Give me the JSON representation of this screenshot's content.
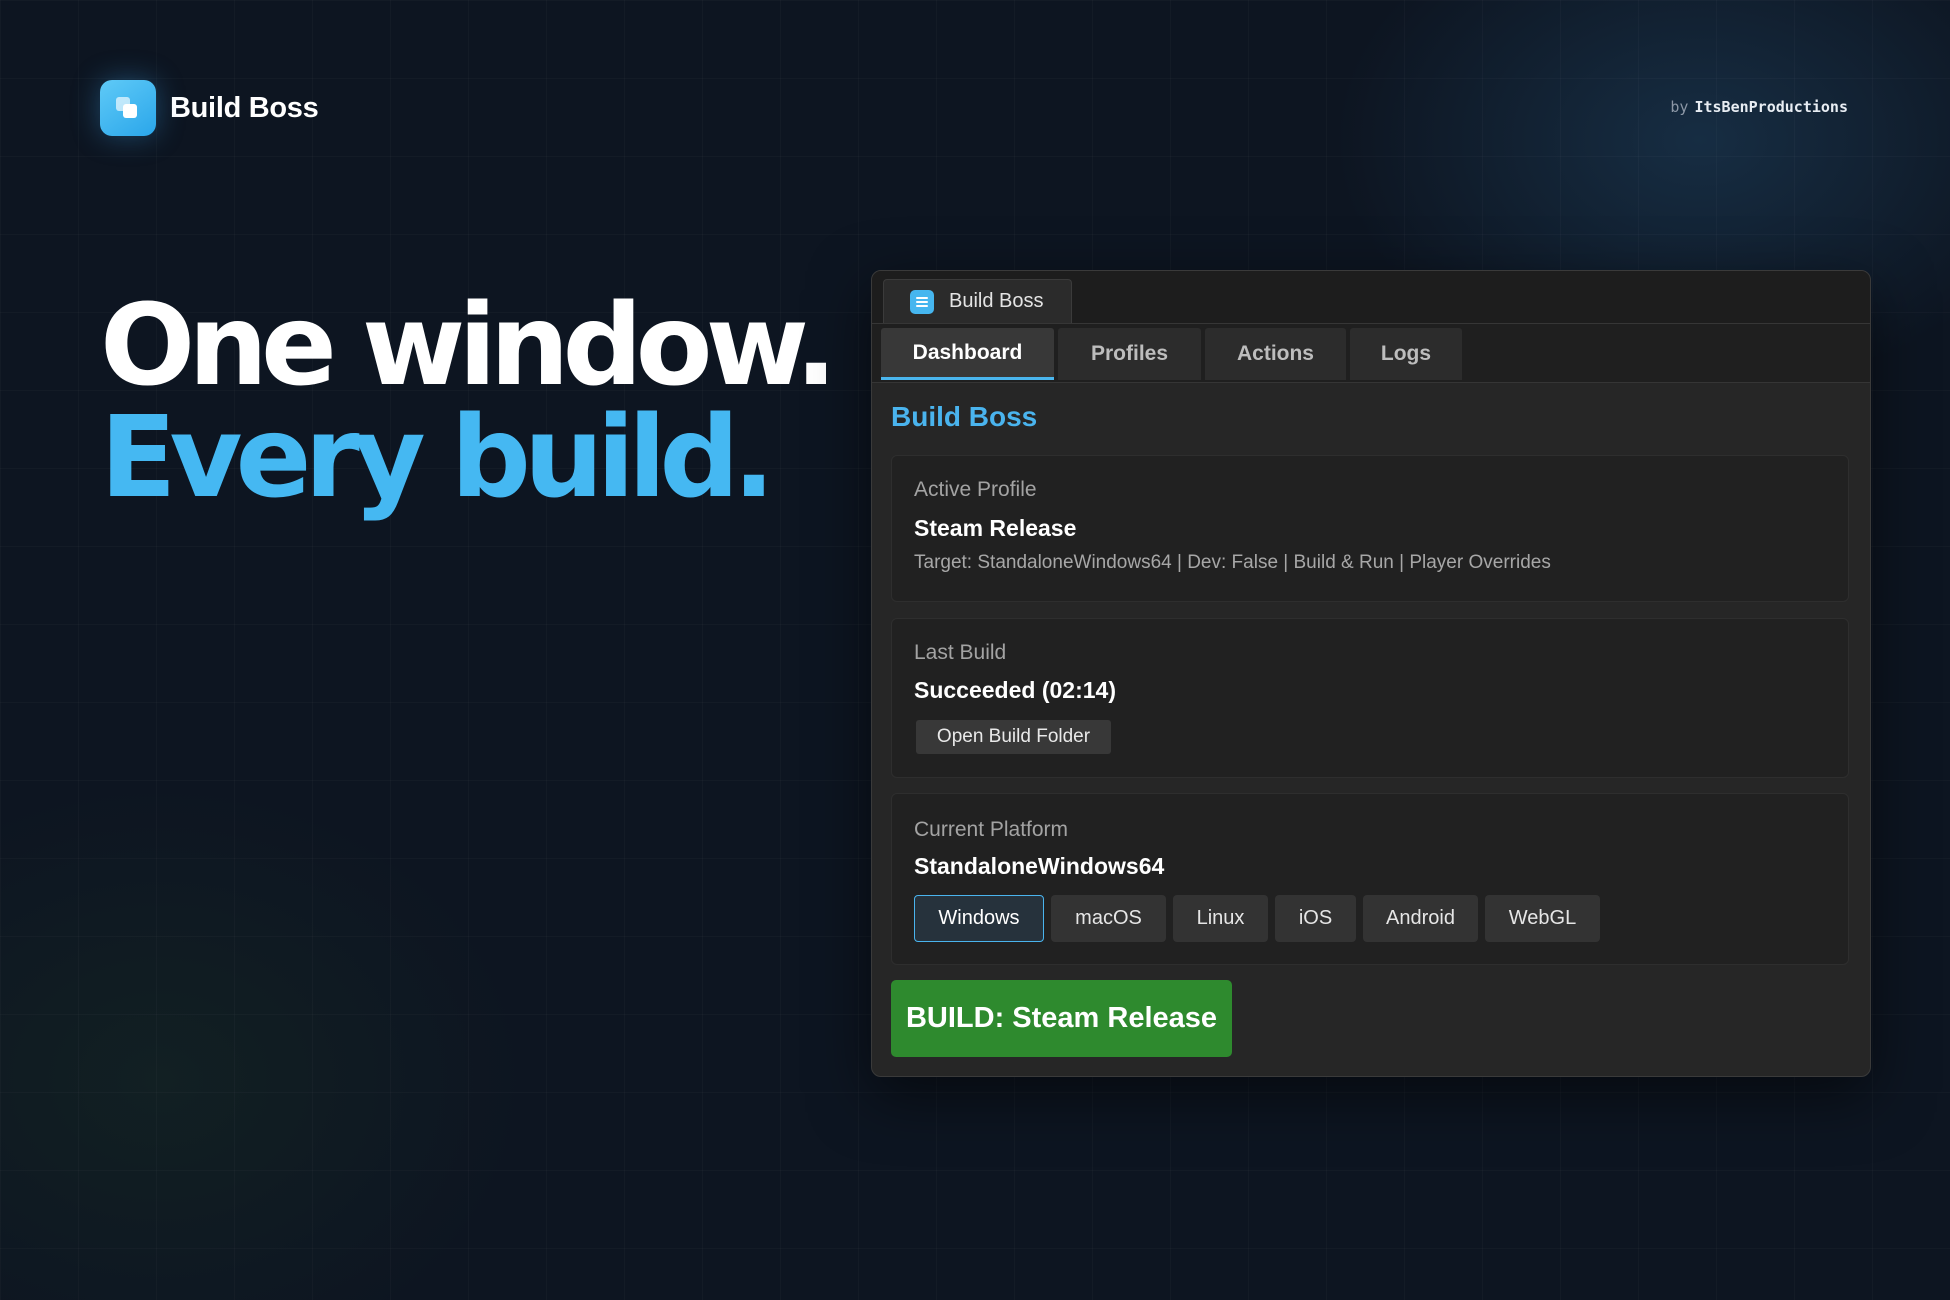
{
  "brand": {
    "name": "Build Boss",
    "by_prefix": "by",
    "by_name": "ItsBenProductions"
  },
  "hero": {
    "line1": "One window.",
    "line2": "Every build."
  },
  "window": {
    "title": "Build Boss",
    "tabs": [
      {
        "label": "Dashboard",
        "active": true
      },
      {
        "label": "Profiles",
        "active": false
      },
      {
        "label": "Actions",
        "active": false
      },
      {
        "label": "Logs",
        "active": false
      }
    ],
    "panel_title": "Build Boss",
    "active_profile": {
      "label": "Active Profile",
      "value": "Steam Release",
      "detail": "Target: StandaloneWindows64 | Dev: False | Build & Run | Player Overrides"
    },
    "last_build": {
      "label": "Last Build",
      "value": "Succeeded (02:14)",
      "button": "Open Build Folder"
    },
    "current_platform": {
      "label": "Current Platform",
      "value": "StandaloneWindows64",
      "options": [
        "Windows",
        "macOS",
        "Linux",
        "iOS",
        "Android",
        "WebGL"
      ],
      "selected": "Windows"
    },
    "build_button": "BUILD: Steam Release"
  },
  "colors": {
    "accent": "#4ab4ee",
    "build_green": "#2e8a2e",
    "background": "#0d1521"
  }
}
